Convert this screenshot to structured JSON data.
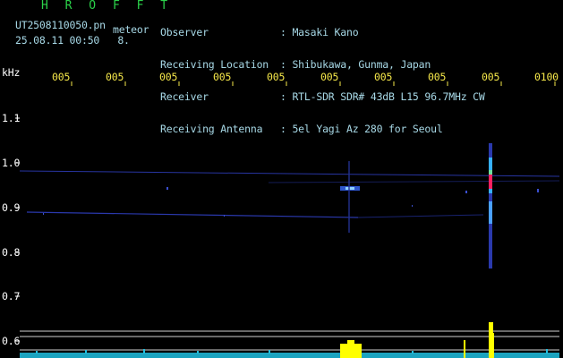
{
  "header": {
    "brand": "H R O F F T",
    "file_name": "UT2508110050.pn",
    "tag": "meteor",
    "date": "25.08.11",
    "time": "00:50",
    "count": "8.",
    "info_rows": [
      {
        "label": "Observer",
        "value": "Masaki Kano"
      },
      {
        "label": "Receiving Location",
        "value": "Shibukawa, Gunma, Japan"
      },
      {
        "label": "Receiver",
        "value": "RTL-SDR SDR# 43dB L15 96.7MHz CW"
      },
      {
        "label": "Receiving Antenna",
        "value": "5el Yagi Az 280 for Seoul"
      }
    ]
  },
  "axes": {
    "y_unit": "kHz",
    "y_ticks": [
      "1.1",
      "1.0",
      "0.9",
      "0.8",
      "0.7",
      "0.6"
    ],
    "x_ticks": [
      "005",
      "005",
      "005",
      "005",
      "005",
      "005",
      "005",
      "005",
      "005",
      "0100"
    ]
  },
  "colors": {
    "background": "#000000",
    "header_text": "#a7d8e6",
    "brand": "#2bd34a",
    "time_ticks": "#f6e84a",
    "axis_text": "#ffffff",
    "trace": "#3344cc",
    "meteor_head": "#ff2060",
    "power_base": "#20c0e0",
    "power_peak": "#ffff00"
  }
}
